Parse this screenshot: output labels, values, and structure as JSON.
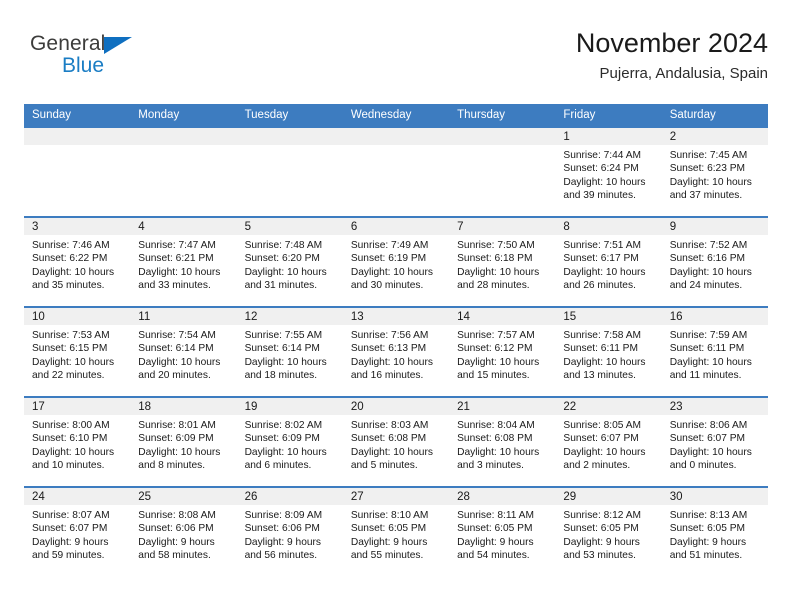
{
  "logo": {
    "word_one": "General",
    "word_two": "Blue",
    "triangle_color": "#0f6fc0",
    "word_two_color": "#1a7dc4"
  },
  "header": {
    "title": "November 2024",
    "subtitle": "Pujerra, Andalusia, Spain"
  },
  "calendar": {
    "header_color": "#3d7cc0",
    "daynum_bg": "#f0f0f0",
    "weekdays": [
      "Sunday",
      "Monday",
      "Tuesday",
      "Wednesday",
      "Thursday",
      "Friday",
      "Saturday"
    ],
    "weeks": [
      [
        {
          "day": "",
          "sunrise": "",
          "sunset": "",
          "daylight_line1": "",
          "daylight_line2": "",
          "empty": true
        },
        {
          "day": "",
          "sunrise": "",
          "sunset": "",
          "daylight_line1": "",
          "daylight_line2": "",
          "empty": true
        },
        {
          "day": "",
          "sunrise": "",
          "sunset": "",
          "daylight_line1": "",
          "daylight_line2": "",
          "empty": true
        },
        {
          "day": "",
          "sunrise": "",
          "sunset": "",
          "daylight_line1": "",
          "daylight_line2": "",
          "empty": true
        },
        {
          "day": "",
          "sunrise": "",
          "sunset": "",
          "daylight_line1": "",
          "daylight_line2": "",
          "empty": true
        },
        {
          "day": "1",
          "sunrise": "Sunrise: 7:44 AM",
          "sunset": "Sunset: 6:24 PM",
          "daylight_line1": "Daylight: 10 hours",
          "daylight_line2": "and 39 minutes."
        },
        {
          "day": "2",
          "sunrise": "Sunrise: 7:45 AM",
          "sunset": "Sunset: 6:23 PM",
          "daylight_line1": "Daylight: 10 hours",
          "daylight_line2": "and 37 minutes."
        }
      ],
      [
        {
          "day": "3",
          "sunrise": "Sunrise: 7:46 AM",
          "sunset": "Sunset: 6:22 PM",
          "daylight_line1": "Daylight: 10 hours",
          "daylight_line2": "and 35 minutes."
        },
        {
          "day": "4",
          "sunrise": "Sunrise: 7:47 AM",
          "sunset": "Sunset: 6:21 PM",
          "daylight_line1": "Daylight: 10 hours",
          "daylight_line2": "and 33 minutes."
        },
        {
          "day": "5",
          "sunrise": "Sunrise: 7:48 AM",
          "sunset": "Sunset: 6:20 PM",
          "daylight_line1": "Daylight: 10 hours",
          "daylight_line2": "and 31 minutes."
        },
        {
          "day": "6",
          "sunrise": "Sunrise: 7:49 AM",
          "sunset": "Sunset: 6:19 PM",
          "daylight_line1": "Daylight: 10 hours",
          "daylight_line2": "and 30 minutes."
        },
        {
          "day": "7",
          "sunrise": "Sunrise: 7:50 AM",
          "sunset": "Sunset: 6:18 PM",
          "daylight_line1": "Daylight: 10 hours",
          "daylight_line2": "and 28 minutes."
        },
        {
          "day": "8",
          "sunrise": "Sunrise: 7:51 AM",
          "sunset": "Sunset: 6:17 PM",
          "daylight_line1": "Daylight: 10 hours",
          "daylight_line2": "and 26 minutes."
        },
        {
          "day": "9",
          "sunrise": "Sunrise: 7:52 AM",
          "sunset": "Sunset: 6:16 PM",
          "daylight_line1": "Daylight: 10 hours",
          "daylight_line2": "and 24 minutes."
        }
      ],
      [
        {
          "day": "10",
          "sunrise": "Sunrise: 7:53 AM",
          "sunset": "Sunset: 6:15 PM",
          "daylight_line1": "Daylight: 10 hours",
          "daylight_line2": "and 22 minutes."
        },
        {
          "day": "11",
          "sunrise": "Sunrise: 7:54 AM",
          "sunset": "Sunset: 6:14 PM",
          "daylight_line1": "Daylight: 10 hours",
          "daylight_line2": "and 20 minutes."
        },
        {
          "day": "12",
          "sunrise": "Sunrise: 7:55 AM",
          "sunset": "Sunset: 6:14 PM",
          "daylight_line1": "Daylight: 10 hours",
          "daylight_line2": "and 18 minutes."
        },
        {
          "day": "13",
          "sunrise": "Sunrise: 7:56 AM",
          "sunset": "Sunset: 6:13 PM",
          "daylight_line1": "Daylight: 10 hours",
          "daylight_line2": "and 16 minutes."
        },
        {
          "day": "14",
          "sunrise": "Sunrise: 7:57 AM",
          "sunset": "Sunset: 6:12 PM",
          "daylight_line1": "Daylight: 10 hours",
          "daylight_line2": "and 15 minutes."
        },
        {
          "day": "15",
          "sunrise": "Sunrise: 7:58 AM",
          "sunset": "Sunset: 6:11 PM",
          "daylight_line1": "Daylight: 10 hours",
          "daylight_line2": "and 13 minutes."
        },
        {
          "day": "16",
          "sunrise": "Sunrise: 7:59 AM",
          "sunset": "Sunset: 6:11 PM",
          "daylight_line1": "Daylight: 10 hours",
          "daylight_line2": "and 11 minutes."
        }
      ],
      [
        {
          "day": "17",
          "sunrise": "Sunrise: 8:00 AM",
          "sunset": "Sunset: 6:10 PM",
          "daylight_line1": "Daylight: 10 hours",
          "daylight_line2": "and 10 minutes."
        },
        {
          "day": "18",
          "sunrise": "Sunrise: 8:01 AM",
          "sunset": "Sunset: 6:09 PM",
          "daylight_line1": "Daylight: 10 hours",
          "daylight_line2": "and 8 minutes."
        },
        {
          "day": "19",
          "sunrise": "Sunrise: 8:02 AM",
          "sunset": "Sunset: 6:09 PM",
          "daylight_line1": "Daylight: 10 hours",
          "daylight_line2": "and 6 minutes."
        },
        {
          "day": "20",
          "sunrise": "Sunrise: 8:03 AM",
          "sunset": "Sunset: 6:08 PM",
          "daylight_line1": "Daylight: 10 hours",
          "daylight_line2": "and 5 minutes."
        },
        {
          "day": "21",
          "sunrise": "Sunrise: 8:04 AM",
          "sunset": "Sunset: 6:08 PM",
          "daylight_line1": "Daylight: 10 hours",
          "daylight_line2": "and 3 minutes."
        },
        {
          "day": "22",
          "sunrise": "Sunrise: 8:05 AM",
          "sunset": "Sunset: 6:07 PM",
          "daylight_line1": "Daylight: 10 hours",
          "daylight_line2": "and 2 minutes."
        },
        {
          "day": "23",
          "sunrise": "Sunrise: 8:06 AM",
          "sunset": "Sunset: 6:07 PM",
          "daylight_line1": "Daylight: 10 hours",
          "daylight_line2": "and 0 minutes."
        }
      ],
      [
        {
          "day": "24",
          "sunrise": "Sunrise: 8:07 AM",
          "sunset": "Sunset: 6:07 PM",
          "daylight_line1": "Daylight: 9 hours",
          "daylight_line2": "and 59 minutes."
        },
        {
          "day": "25",
          "sunrise": "Sunrise: 8:08 AM",
          "sunset": "Sunset: 6:06 PM",
          "daylight_line1": "Daylight: 9 hours",
          "daylight_line2": "and 58 minutes."
        },
        {
          "day": "26",
          "sunrise": "Sunrise: 8:09 AM",
          "sunset": "Sunset: 6:06 PM",
          "daylight_line1": "Daylight: 9 hours",
          "daylight_line2": "and 56 minutes."
        },
        {
          "day": "27",
          "sunrise": "Sunrise: 8:10 AM",
          "sunset": "Sunset: 6:05 PM",
          "daylight_line1": "Daylight: 9 hours",
          "daylight_line2": "and 55 minutes."
        },
        {
          "day": "28",
          "sunrise": "Sunrise: 8:11 AM",
          "sunset": "Sunset: 6:05 PM",
          "daylight_line1": "Daylight: 9 hours",
          "daylight_line2": "and 54 minutes."
        },
        {
          "day": "29",
          "sunrise": "Sunrise: 8:12 AM",
          "sunset": "Sunset: 6:05 PM",
          "daylight_line1": "Daylight: 9 hours",
          "daylight_line2": "and 53 minutes."
        },
        {
          "day": "30",
          "sunrise": "Sunrise: 8:13 AM",
          "sunset": "Sunset: 6:05 PM",
          "daylight_line1": "Daylight: 9 hours",
          "daylight_line2": "and 51 minutes."
        }
      ]
    ]
  }
}
